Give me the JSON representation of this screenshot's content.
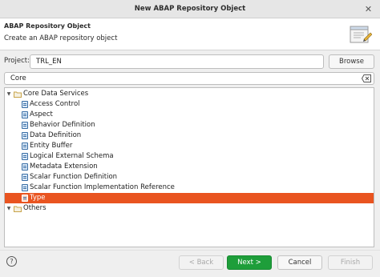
{
  "window": {
    "title": "New ABAP Repository Object"
  },
  "header": {
    "title": "ABAP Repository Object",
    "description": "Create an ABAP repository object"
  },
  "project": {
    "label": "Project:",
    "value": "TRL_EN",
    "browse_label": "Browse"
  },
  "filter": {
    "value": "Core"
  },
  "tree": {
    "root": "Core Data Services",
    "items": [
      "Access Control",
      "Aspect",
      "Behavior Definition",
      "Data Definition",
      "Entity Buffer",
      "Logical External Schema",
      "Metadata Extension",
      "Scalar Function Definition",
      "Scalar Function Implementation Reference",
      "Type"
    ],
    "selected": "Type",
    "others": "Others"
  },
  "footer": {
    "back_label": "< Back",
    "next_label": "Next >",
    "cancel_label": "Cancel",
    "finish_label": "Finish"
  },
  "colors": {
    "selection": "#e95420",
    "primary": "#1e9e3a"
  }
}
